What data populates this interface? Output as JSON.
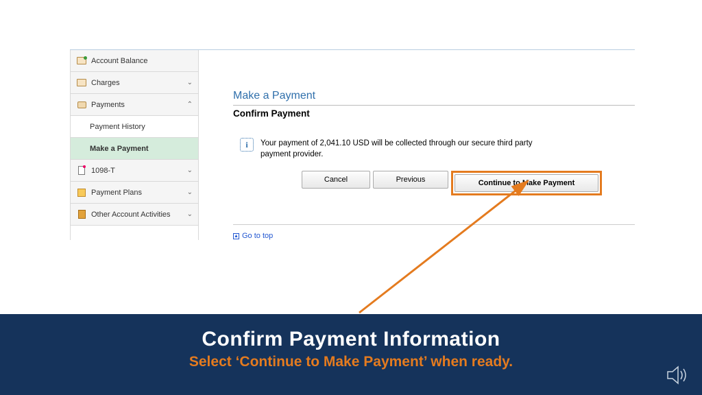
{
  "sidebar": {
    "items": [
      {
        "label": "Account Balance",
        "expandable": false
      },
      {
        "label": "Charges",
        "expandable": true,
        "open": false
      },
      {
        "label": "Payments",
        "expandable": true,
        "open": true,
        "children": [
          {
            "label": "Payment History",
            "active": false
          },
          {
            "label": "Make a Payment",
            "active": true
          }
        ]
      },
      {
        "label": "1098-T",
        "expandable": true,
        "open": false
      },
      {
        "label": "Payment Plans",
        "expandable": true,
        "open": false
      },
      {
        "label": "Other Account Activities",
        "expandable": true,
        "open": false
      }
    ]
  },
  "main": {
    "page_title": "Make a Payment",
    "section_title": "Confirm Payment",
    "info_text": "Your payment of 2,041.10 USD will be collected through our secure third party payment provider.",
    "buttons": {
      "cancel": "Cancel",
      "previous": "Previous",
      "continue": "Continue to Make Payment"
    },
    "go_top": "Go to top"
  },
  "banner": {
    "title": "Confirm Payment Information",
    "subtitle": "Select ‘Continue to Make Payment’ when ready."
  },
  "colors": {
    "highlight": "#e47b1f",
    "banner_bg": "#15335b"
  }
}
